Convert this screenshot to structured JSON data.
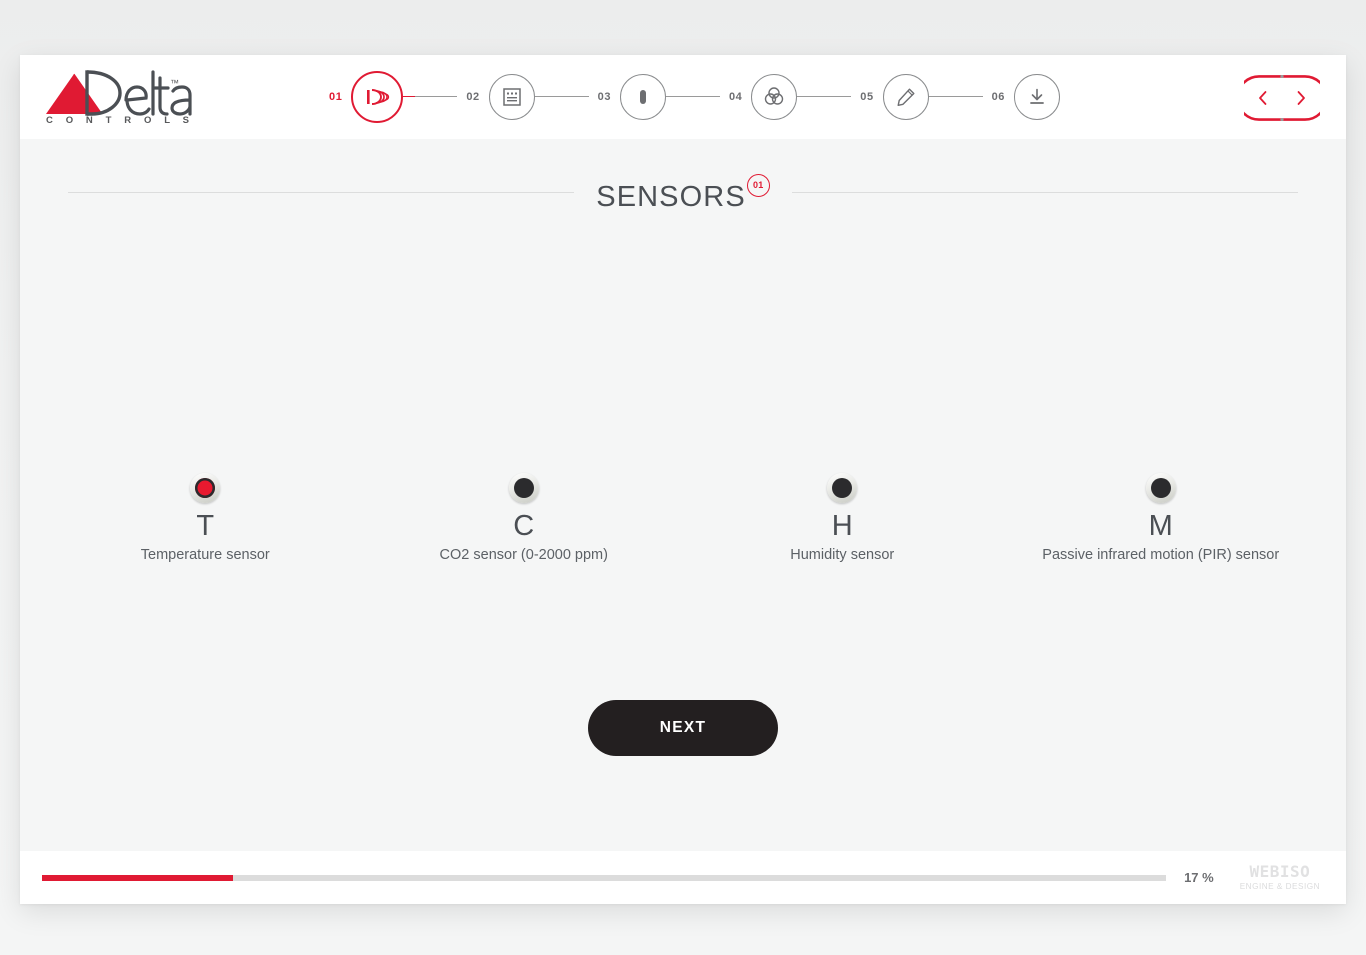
{
  "brand": {
    "logo_name": "Delta",
    "logo_trademark": "™",
    "logo_subtitle": "C O N T R O L S"
  },
  "steps": [
    {
      "number": "01",
      "icon": "signal-wave-icon",
      "active": true
    },
    {
      "number": "02",
      "icon": "display-keypad-icon",
      "active": false
    },
    {
      "number": "03",
      "icon": "capsule-icon",
      "active": false
    },
    {
      "number": "04",
      "icon": "venn-circles-icon",
      "active": false
    },
    {
      "number": "05",
      "icon": "pencil-icon",
      "active": false
    },
    {
      "number": "06",
      "icon": "download-icon",
      "active": false
    }
  ],
  "nav": {
    "prev_label": "Previous step",
    "next_label": "Next step",
    "accent_color": "#e01a33"
  },
  "page": {
    "title": "SENSORS",
    "badge": "01"
  },
  "sensors": [
    {
      "letter": "T",
      "label": "Temperature sensor",
      "selected": true
    },
    {
      "letter": "C",
      "label": "CO2 sensor (0-2000 ppm)",
      "selected": false
    },
    {
      "letter": "H",
      "label": "Humidity sensor",
      "selected": false
    },
    {
      "letter": "M",
      "label": "Passive infrared motion (PIR) sensor",
      "selected": false
    }
  ],
  "actions": {
    "next_label": "NEXT"
  },
  "footer": {
    "progress_percent_label": "17 %",
    "progress_value": 17,
    "progress_color": "#e01a33",
    "vendor_name": "WEBISO",
    "vendor_tagline": "ENGINE & DESIGN"
  }
}
